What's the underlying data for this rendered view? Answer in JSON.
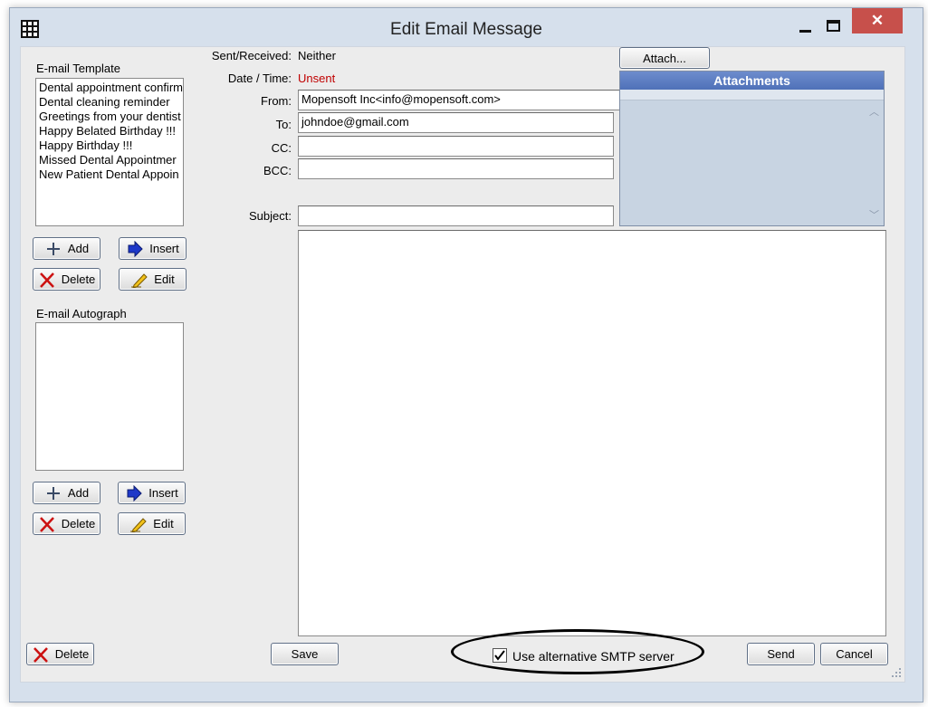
{
  "window": {
    "title": "Edit Email Message"
  },
  "template": {
    "label": "E-mail Template",
    "items": [
      "Dental appointment confirm",
      "Dental cleaning reminder",
      "Greetings from your dentist",
      "Happy Belated Birthday !!!",
      "Happy Birthday !!!",
      "Missed Dental Appointmer",
      "New Patient Dental Appoin"
    ],
    "add": "Add",
    "insert": "Insert",
    "delete": "Delete",
    "edit": "Edit"
  },
  "autograph": {
    "label": "E-mail Autograph",
    "add": "Add",
    "insert": "Insert",
    "delete": "Delete",
    "edit": "Edit"
  },
  "message": {
    "sent_label": "Sent/Received:",
    "sent_value": "Neither",
    "date_label": "Date / Time:",
    "date_value": "Unsent",
    "from_label": "From:",
    "from_value": "Mopensoft Inc<info@mopensoft.com>",
    "to_label": "To:",
    "to_value": "johndoe@gmail.com",
    "cc_label": "CC:",
    "cc_value": "",
    "bcc_label": "BCC:",
    "bcc_value": "",
    "subject_label": "Subject:",
    "subject_value": "",
    "body": ""
  },
  "attachments": {
    "attach_button": "Attach...",
    "header": "Attachments"
  },
  "footer": {
    "delete": "Delete",
    "save": "Save",
    "smtp_checkbox": "Use alternative SMTP server",
    "smtp_checked": true,
    "send": "Send",
    "cancel": "Cancel"
  },
  "colors": {
    "unsent": "#c00000",
    "attachments_header": "#4f71b8",
    "attachments_bg": "#c8d4e2"
  }
}
